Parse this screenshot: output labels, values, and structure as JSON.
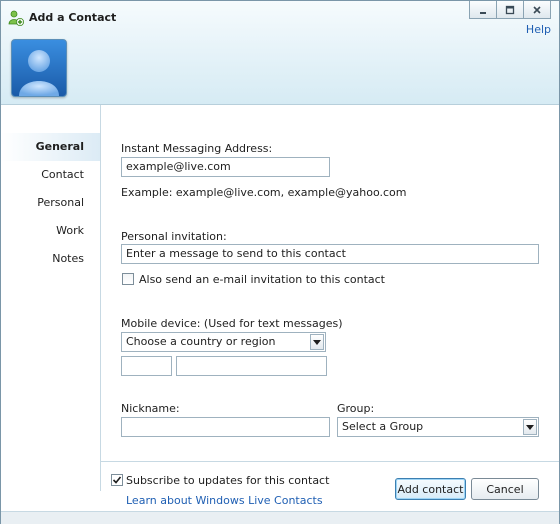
{
  "window": {
    "title": "Add a Contact",
    "help_label": "Help"
  },
  "sidebar": {
    "items": [
      {
        "label": "General",
        "active": true
      },
      {
        "label": "Contact",
        "active": false
      },
      {
        "label": "Personal",
        "active": false
      },
      {
        "label": "Work",
        "active": false
      },
      {
        "label": "Notes",
        "active": false
      }
    ]
  },
  "form": {
    "im_label": "Instant Messaging Address:",
    "im_value": "example@live.com",
    "im_example": "Example: example@live.com, example@yahoo.com",
    "invitation_label": "Personal invitation:",
    "invitation_placeholder": "Enter a message to send to this contact",
    "email_invite_label": "Also send an e-mail invitation to this contact",
    "email_invite_checked": false,
    "mobile_label": "Mobile device: (Used for text messages)",
    "country_select": "Choose a country or region",
    "nickname_label": "Nickname:",
    "group_label": "Group:",
    "group_select": "Select a Group"
  },
  "footer": {
    "subscribe_label": "Subscribe to updates for this contact",
    "subscribe_checked": true,
    "learn_link": "Learn about Windows Live Contacts",
    "add_button": "Add contact",
    "cancel_button": "Cancel"
  },
  "icons": {
    "app": "messenger-add-contact-icon",
    "avatar": "default-user-avatar",
    "minimize": "minimize-icon",
    "restore": "restore-icon",
    "close": "close-icon",
    "dropdown": "chevron-down-icon",
    "check": "checkmark-icon"
  },
  "colors": {
    "accent": "#1f5fb3",
    "header_bg": "#e4f2f8",
    "nav_active": "#dcebf5",
    "default_button_border": "#3c7fb1"
  }
}
